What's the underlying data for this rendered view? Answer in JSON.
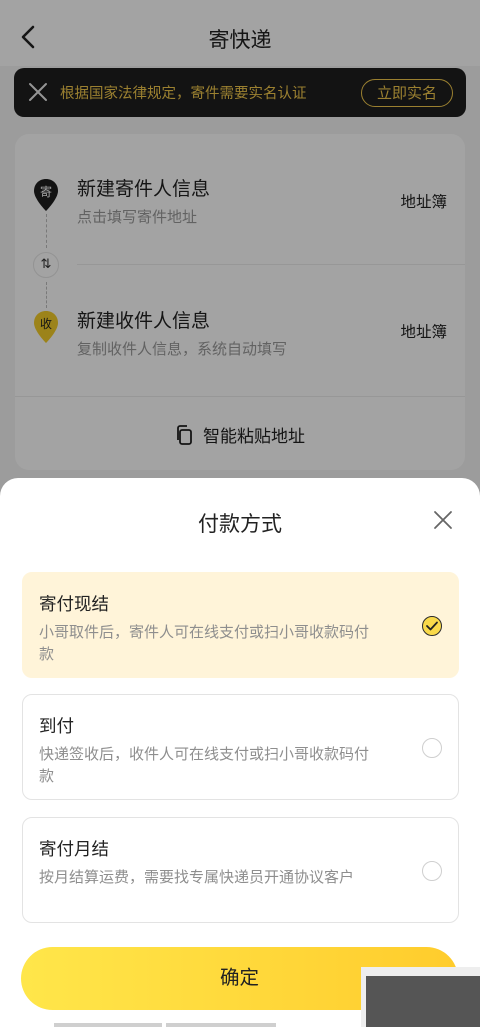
{
  "header": {
    "title": "寄快递"
  },
  "notice": {
    "text": "根据国家法律规定，寄件需要实名认证",
    "button": "立即实名"
  },
  "sender": {
    "badge": "寄",
    "title": "新建寄件人信息",
    "subtitle": "点击填写寄件地址",
    "book": "地址簿"
  },
  "receiver": {
    "badge": "收",
    "title": "新建收件人信息",
    "subtitle": "复制收件人信息，系统自动填写",
    "book": "地址簿"
  },
  "paste": {
    "label": "智能粘贴地址"
  },
  "sheet": {
    "title": "付款方式",
    "options": [
      {
        "title": "寄付现结",
        "desc": "小哥取件后，寄件人可在线支付或扫小哥收款码付款",
        "selected": true
      },
      {
        "title": "到付",
        "desc": "快递签收后，收件人可在线支付或扫小哥收款码付款",
        "selected": false
      },
      {
        "title": "寄付月结",
        "desc": "按月结算运费，需要找专属快递员开通协议客户",
        "selected": false
      }
    ],
    "confirm": "确定"
  },
  "colors": {
    "accent": "#ffd83a",
    "selected_bg": "#fff4d9",
    "notice_bg": "#1f1f1f",
    "notice_text": "#f2c94c"
  }
}
